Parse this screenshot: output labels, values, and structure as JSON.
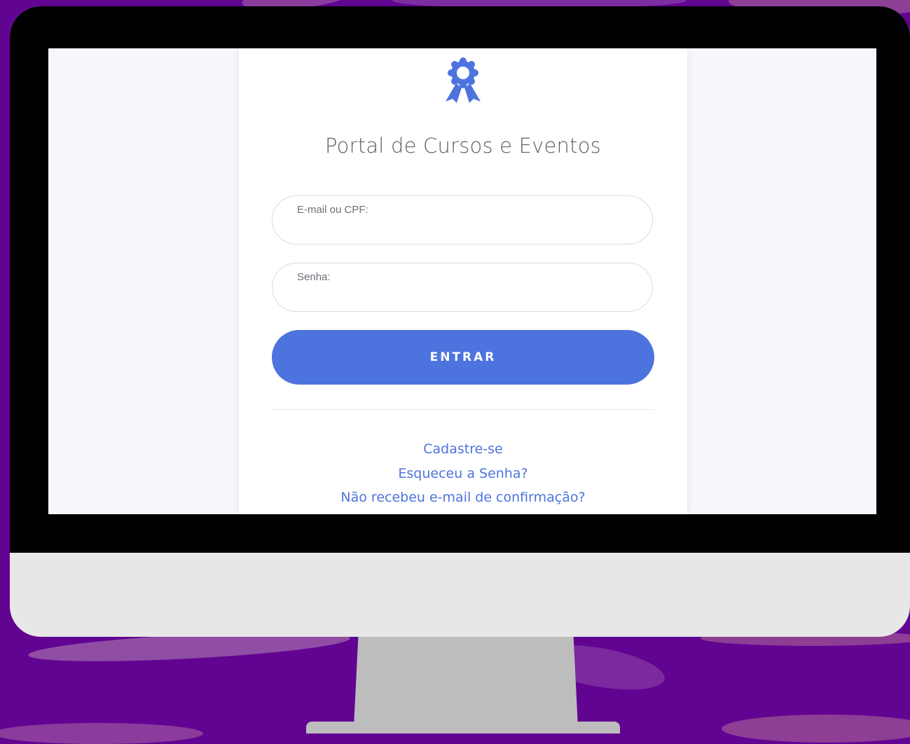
{
  "portal": {
    "title": "Portal de Cursos e Eventos",
    "logo_icon": "award-ribbon-icon",
    "accent_color": "#4d74de"
  },
  "login": {
    "email_label": "E-mail ou CPF:",
    "email_value": "",
    "password_label": "Senha:",
    "password_value": "",
    "submit_label": "ENTRAR"
  },
  "links": {
    "register": "Cadastre-se",
    "forgot_password": "Esqueceu a Senha?",
    "resend_confirmation": "Não recebeu e-mail de confirmação?"
  }
}
